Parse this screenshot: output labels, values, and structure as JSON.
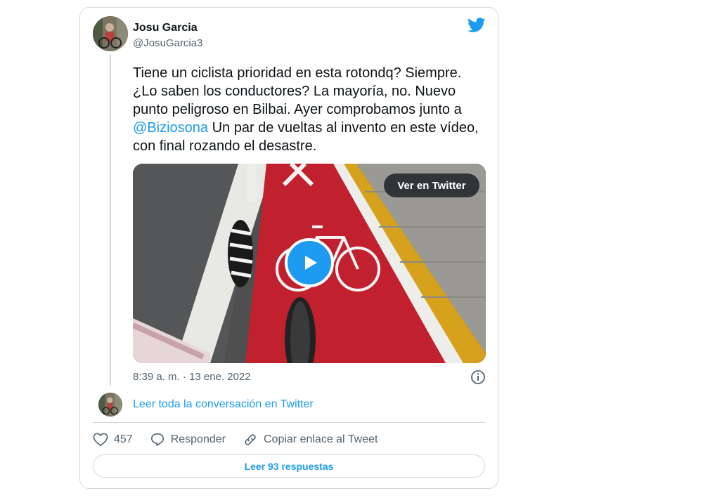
{
  "tweet": {
    "author_name": "Josu Garcia",
    "author_handle": "@JosuGarcia3",
    "text_before": "Tiene un ciclista prioridad en esta rotondq? Siempre. ¿Lo saben los conductores? La mayoría, no. Nuevo punto peligroso en Bilbai. Ayer comprobamos junto a ",
    "mention": "@Biziosona",
    "text_after": " Un par de vueltas al invento en este vídeo, con final rozando el desastre.",
    "timestamp": "8:39 a. m. · 13 ene. 2022"
  },
  "media": {
    "watch_label": "Ver en Twitter",
    "play_icon": "play-icon"
  },
  "thread": {
    "read_conversation": "Leer toda la conversación en Twitter"
  },
  "actions": {
    "like_count": "457",
    "reply_label": "Responder",
    "copy_link_label": "Copiar enlace al Tweet",
    "read_replies": "Leer 93 respuestas"
  },
  "colors": {
    "accent": "#1d9bf0",
    "text": "#0f1419",
    "muted": "#536471",
    "border": "#cfd9de"
  }
}
